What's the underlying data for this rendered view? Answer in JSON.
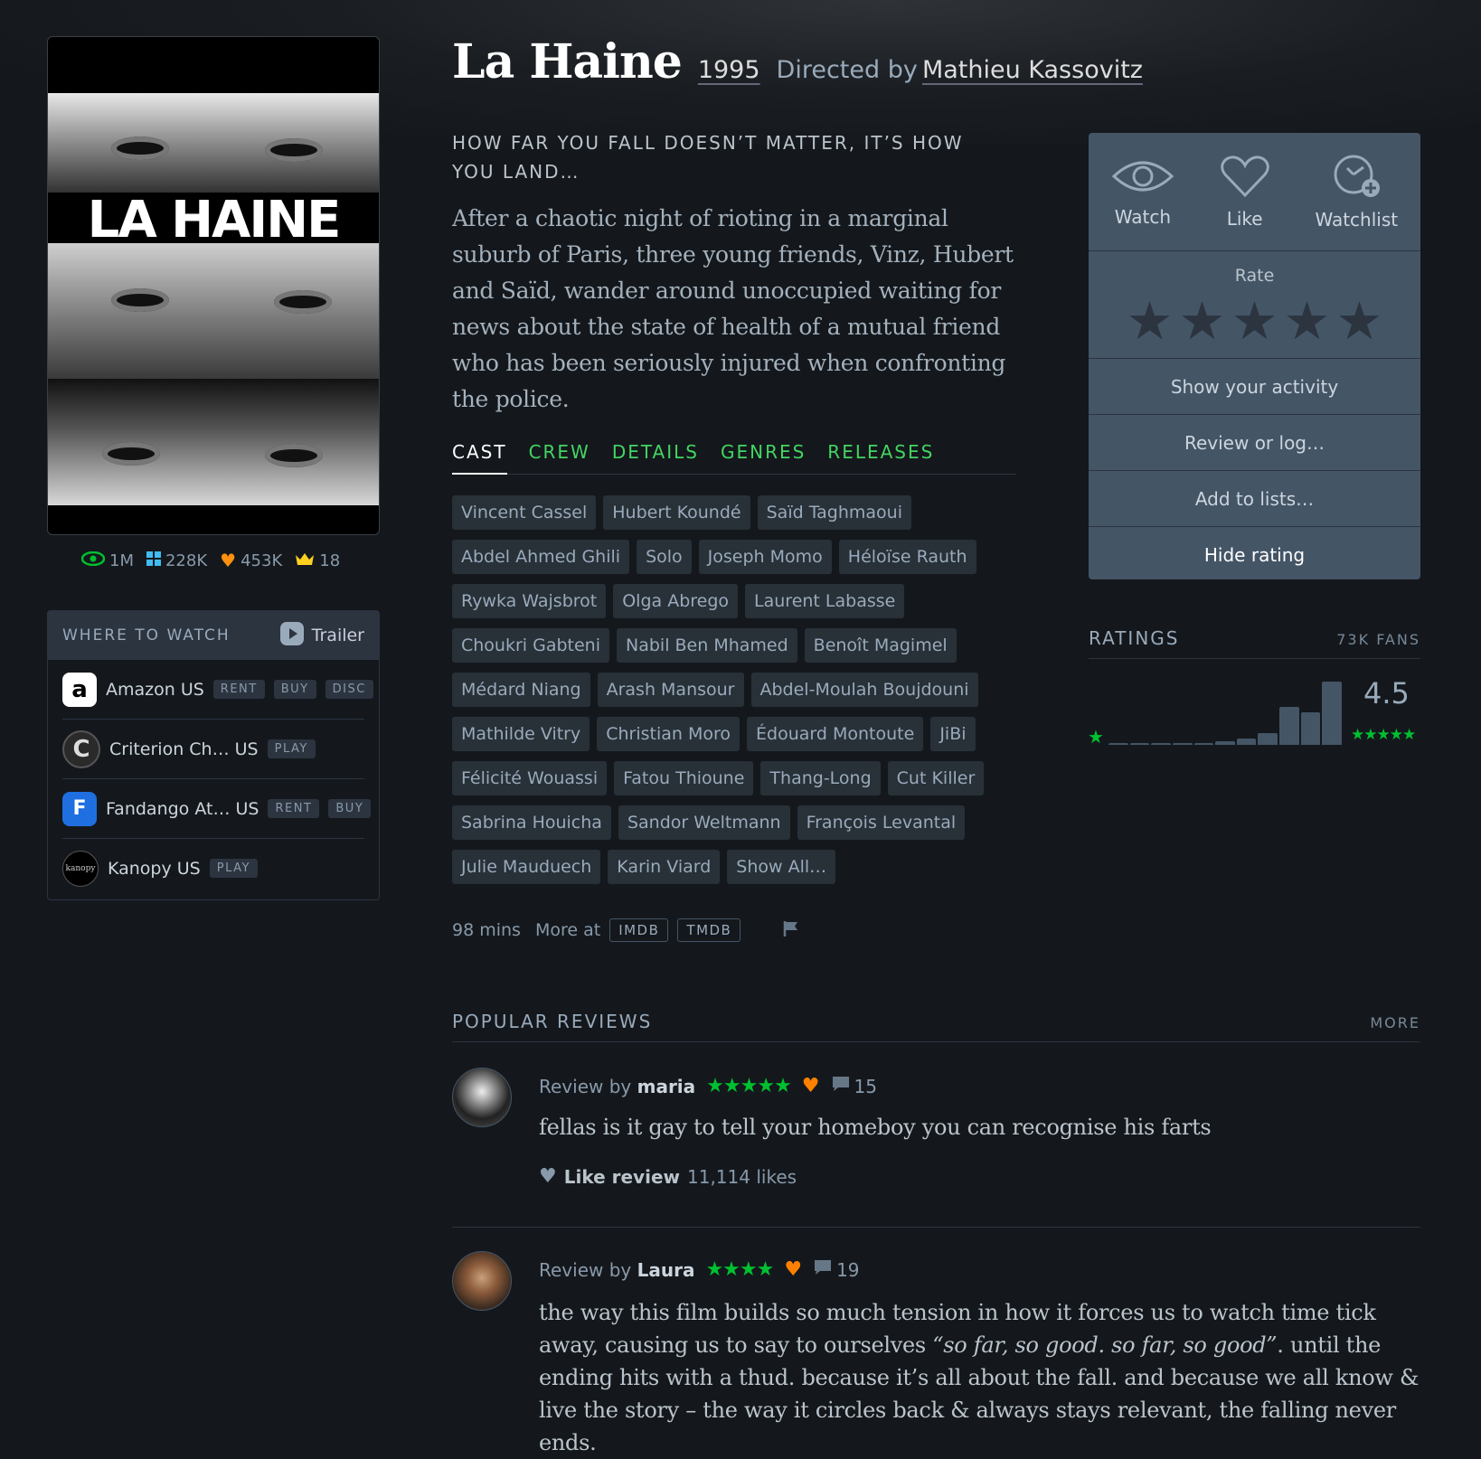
{
  "film": {
    "title": "La Haine",
    "year": "1995",
    "directed_by": "Directed by",
    "director": "Mathieu Kassovitz",
    "poster_title": "LA HAINE",
    "tagline": "HOW FAR YOU FALL DOESN’T MATTER, IT’S HOW YOU LAND…",
    "synopsis": "After a chaotic night of rioting in a marginal suburb of Paris, three young friends, Vinz, Hubert and Saïd, wander around unoccupied waiting for news about the state of health of a mutual friend who has been seriously injured when confronting the police."
  },
  "stats": {
    "watched": "1M",
    "lists": "228K",
    "likes": "453K",
    "top": "18"
  },
  "where_to_watch": {
    "title": "WHERE TO WATCH",
    "trailer": "Trailer",
    "services": [
      {
        "name": "Amazon US",
        "logo": "a",
        "tags": [
          "RENT",
          "BUY",
          "DISC"
        ]
      },
      {
        "name": "Criterion Ch…  US",
        "logo": "C",
        "tags": [
          "PLAY"
        ]
      },
      {
        "name": "Fandango At…  US",
        "logo": "F",
        "tags": [
          "RENT",
          "BUY"
        ]
      },
      {
        "name": "Kanopy US",
        "logo": "kanopy",
        "tags": [
          "PLAY"
        ]
      }
    ]
  },
  "tabs": [
    "CAST",
    "CREW",
    "DETAILS",
    "GENRES",
    "RELEASES"
  ],
  "cast": [
    "Vincent Cassel",
    "Hubert Koundé",
    "Saïd Taghmaoui",
    "Abdel Ahmed Ghili",
    "Solo",
    "Joseph Momo",
    "Héloïse Rauth",
    "Rywka Wajsbrot",
    "Olga Abrego",
    "Laurent Labasse",
    "Choukri Gabteni",
    "Nabil Ben Mhamed",
    "Benoît Magimel",
    "Médard Niang",
    "Arash Mansour",
    "Abdel-Moulah Boujdouni",
    "Mathilde Vitry",
    "Christian Moro",
    "Édouard Montoute",
    "JiBi",
    "Félicité Wouassi",
    "Fatou Thioune",
    "Thang-Long",
    "Cut Killer",
    "Sabrina Houicha",
    "Sandor Weltmann",
    "François Levantal",
    "Julie Mauduech",
    "Karin Viard",
    "Show All…"
  ],
  "meta": {
    "runtime": "98 mins",
    "more_at": "More at",
    "imdb": "IMDB",
    "tmdb": "TMDB"
  },
  "actions": {
    "watch": "Watch",
    "like": "Like",
    "watchlist": "Watchlist",
    "rate": "Rate",
    "show_activity": "Show your activity",
    "review": "Review or log…",
    "add_lists": "Add to lists…",
    "hide_rating": "Hide rating"
  },
  "ratings": {
    "title": "RATINGS",
    "fans": "73K FANS",
    "average": "4.5",
    "min_star": "★",
    "max_stars": "★★★★★",
    "histogram": [
      0.02,
      0.02,
      0.02,
      0.03,
      0.03,
      0.05,
      0.1,
      0.18,
      0.58,
      0.5,
      0.97
    ]
  },
  "reviews": {
    "title": "POPULAR REVIEWS",
    "more": "MORE",
    "items": [
      {
        "prefix": "Review by",
        "author": "maria",
        "stars": "★★★★★",
        "comments": "15",
        "body": "fellas is it gay to tell your homeboy you can recognise his farts",
        "like_label": "Like review",
        "likes": "11,114 likes"
      },
      {
        "prefix": "Review by",
        "author": "Laura",
        "stars": "★★★★",
        "comments": "19",
        "body_before": "the way this film builds so much tension in how it forces us to watch time tick away, causing us to say to ourselves ",
        "body_quote": "“so far, so good. so far, so good”",
        "body_after": ". until the ending hits with a thud. because it’s all about the fall. and because we all know & live the story – the way it circles back & always stays relevant, the falling never ends."
      }
    ]
  },
  "colors": {
    "background": "#14181c",
    "green": "#00c030",
    "orange": "#ff8000",
    "panel": "#445566",
    "chip": "#283038"
  }
}
